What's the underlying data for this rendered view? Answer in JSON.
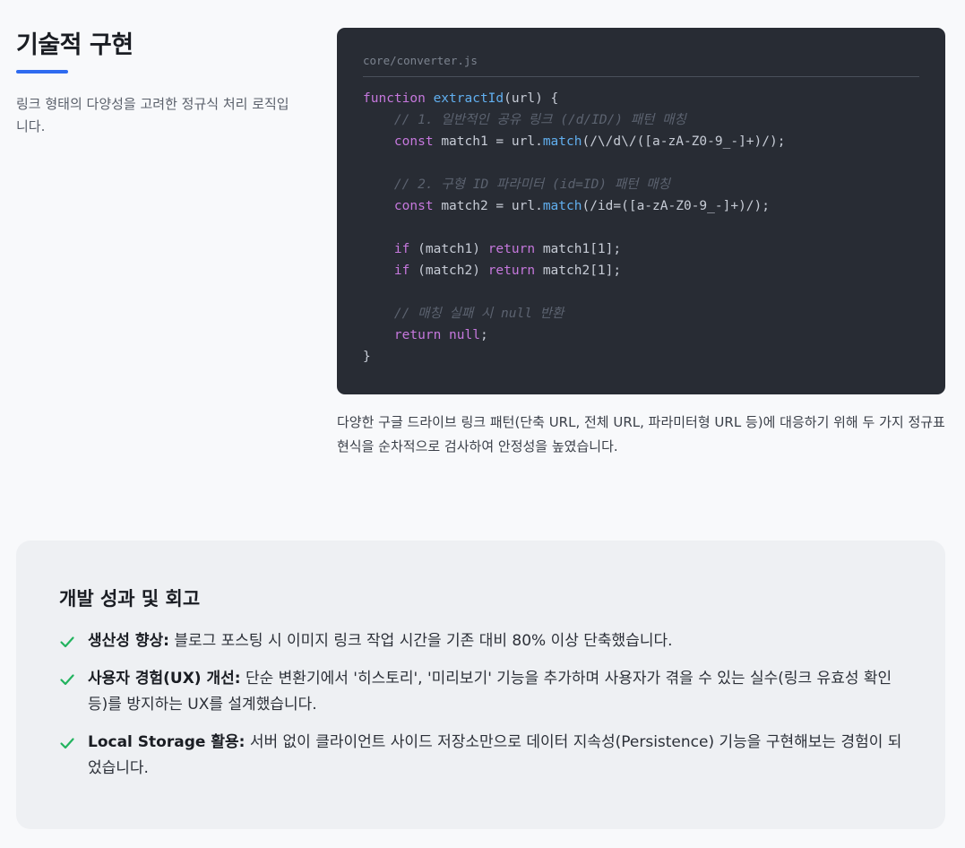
{
  "tech": {
    "title": "기술적 구현",
    "description": "링크 형태의 다양성을 고려한 정규식 처리 로직입니다."
  },
  "code": {
    "filename": "core/converter.js",
    "lines": [
      [
        {
          "t": "kw",
          "v": "function "
        },
        {
          "t": "fn",
          "v": "extractId"
        },
        {
          "t": "tx",
          "v": "(url) {"
        }
      ],
      [
        {
          "t": "tx",
          "v": "    "
        },
        {
          "t": "cm",
          "v": "// 1. 일반적인 공유 링크 (/d/ID/) 패턴 매칭"
        }
      ],
      [
        {
          "t": "tx",
          "v": "    "
        },
        {
          "t": "kw",
          "v": "const "
        },
        {
          "t": "tx",
          "v": "match1 = url."
        },
        {
          "t": "fn",
          "v": "match"
        },
        {
          "t": "tx",
          "v": "(/\\/d\\/([a-zA-Z0-9_-]+)/);"
        }
      ],
      [],
      [
        {
          "t": "tx",
          "v": "    "
        },
        {
          "t": "cm",
          "v": "// 2. 구형 ID 파라미터 (id=ID) 패턴 매칭"
        }
      ],
      [
        {
          "t": "tx",
          "v": "    "
        },
        {
          "t": "kw",
          "v": "const "
        },
        {
          "t": "tx",
          "v": "match2 = url."
        },
        {
          "t": "fn",
          "v": "match"
        },
        {
          "t": "tx",
          "v": "(/id=([a-zA-Z0-9_-]+)/);"
        }
      ],
      [],
      [
        {
          "t": "tx",
          "v": "    "
        },
        {
          "t": "kw",
          "v": "if "
        },
        {
          "t": "tx",
          "v": "(match1) "
        },
        {
          "t": "kw",
          "v": "return "
        },
        {
          "t": "tx",
          "v": "match1[1];"
        }
      ],
      [
        {
          "t": "tx",
          "v": "    "
        },
        {
          "t": "kw",
          "v": "if "
        },
        {
          "t": "tx",
          "v": "(match2) "
        },
        {
          "t": "kw",
          "v": "return "
        },
        {
          "t": "tx",
          "v": "match2[1];"
        }
      ],
      [],
      [
        {
          "t": "tx",
          "v": "    "
        },
        {
          "t": "cm",
          "v": "// 매칭 실패 시 null 반환"
        }
      ],
      [
        {
          "t": "tx",
          "v": "    "
        },
        {
          "t": "kw",
          "v": "return null"
        },
        {
          "t": "tx",
          "v": ";"
        }
      ],
      [
        {
          "t": "tx",
          "v": "}"
        }
      ]
    ],
    "caption": "다양한 구글 드라이브 링크 패턴(단축 URL, 전체 URL, 파라미터형 URL 등)에 대응하기 위해 두 가지 정규표현식을 순차적으로 검사하여 안정성을 높였습니다."
  },
  "retro": {
    "title": "개발 성과 및 회고",
    "items": [
      {
        "label": "생산성 향상:",
        "text": " 블로그 포스팅 시 이미지 링크 작업 시간을 기존 대비 80% 이상 단축했습니다."
      },
      {
        "label": "사용자 경험(UX) 개선:",
        "text": " 단순 변환기에서 '히스토리', '미리보기' 기능을 추가하며 사용자가 겪을 수 있는 실수(링크 유효성 확인 등)를 방지하는 UX를 설계했습니다."
      },
      {
        "label": "Local Storage 활용:",
        "text": " 서버 없이 클라이언트 사이드 저장소만으로 데이터 지속성(Persistence) 기능을 구현해보는 경험이 되었습니다."
      }
    ]
  },
  "colors": {
    "accent": "#2f6bf0",
    "check": "#22b35e",
    "code_bg": "#282c34"
  }
}
